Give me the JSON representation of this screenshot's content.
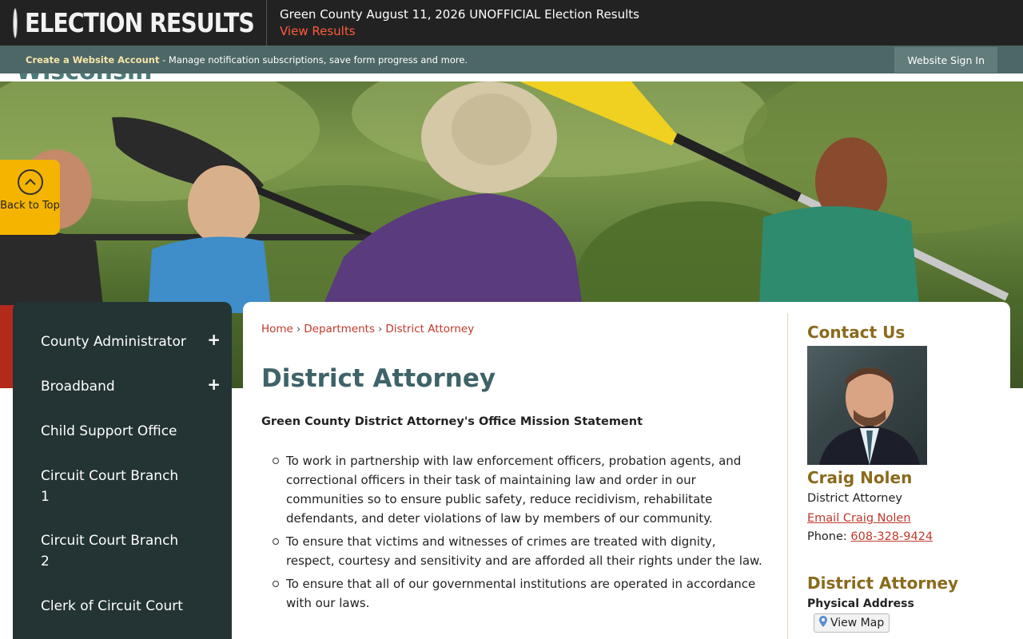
{
  "alert": {
    "brand": "ELECTION RESULTS",
    "title": "Green County August 11, 2026 UNOFFICIAL Election Results",
    "link": "View Results"
  },
  "account": {
    "create_link": "Create a Website Account",
    "description": " - Manage notification subscriptions, save form progress and more.",
    "signin": "Website Sign In"
  },
  "header": {
    "logo_peek": "Wisconsin"
  },
  "back_to_top": {
    "label": "Back to Top"
  },
  "sidebar": {
    "items": [
      {
        "label": "County Administrator",
        "expandable": "+"
      },
      {
        "label": "Broadband",
        "expandable": "+"
      },
      {
        "label": "Child Support Office"
      },
      {
        "label": "Circuit Court Branch 1"
      },
      {
        "label": "Circuit Court Branch 2"
      },
      {
        "label": "Clerk of Circuit Court"
      }
    ]
  },
  "breadcrumb": {
    "home": "Home",
    "departments": "Departments",
    "current": "District Attorney",
    "separator": "›"
  },
  "main": {
    "title": "District Attorney",
    "mission_heading": "Green County District Attorney's Office Mission Statement",
    "mission_items": [
      "To work in partnership with law enforcement officers, probation agents, and correctional officers in their task of maintaining law and order in our communities so to ensure public safety, reduce recidivism,  rehabilitate defendants, and deter violations of law by members of our community.",
      "To ensure that victims and witnesses of crimes are treated with dignity, respect, courtesy and sensitivity and are afforded all their rights under the law.",
      "To ensure that all of our governmental institutions are operated in accordance with our laws."
    ]
  },
  "contact": {
    "heading": "Contact Us",
    "name": "Craig Nolen",
    "role": "District Attorney",
    "email_link": "Email Craig Nolen",
    "phone_label": "Phone: ",
    "phone": "608-328-9424",
    "section_heading": "District Attorney",
    "physical_address_label": "Physical Address",
    "map_button": "View Map"
  },
  "colors": {
    "alert_bg": "#222222",
    "account_bg": "#4d6767",
    "sidebar_bg": "#243333",
    "title_teal": "#3e6368",
    "contact_gold": "#8a6a1c",
    "link_red": "#c0392b",
    "back_to_top_yellow": "#f5b400"
  }
}
